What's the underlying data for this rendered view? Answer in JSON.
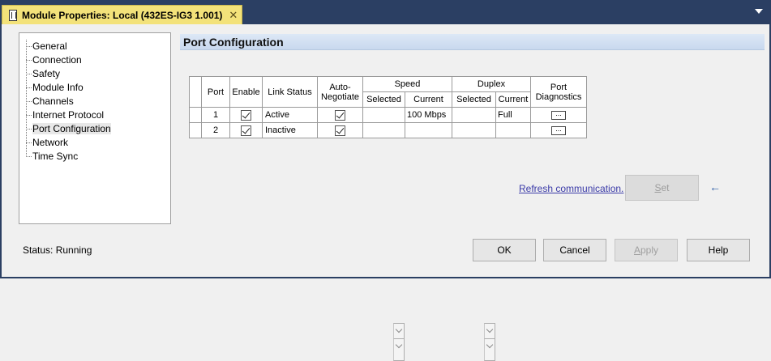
{
  "window": {
    "tab_title": "Module Properties: Local (432ES-IG3 1.001)",
    "close_glyph": "✕"
  },
  "tree": {
    "items": [
      {
        "label": "General",
        "selected": false
      },
      {
        "label": "Connection",
        "selected": false
      },
      {
        "label": "Safety",
        "selected": false
      },
      {
        "label": "Module Info",
        "selected": false
      },
      {
        "label": "Channels",
        "selected": false
      },
      {
        "label": "Internet Protocol",
        "selected": false
      },
      {
        "label": "Port Configuration",
        "selected": true
      },
      {
        "label": "Network",
        "selected": false
      },
      {
        "label": "Time Sync",
        "selected": false
      }
    ]
  },
  "section": {
    "title": "Port Configuration"
  },
  "table": {
    "headers": {
      "port": "Port",
      "enable": "Enable",
      "link_status": "Link Status",
      "auto_negotiate_1": "Auto-",
      "auto_negotiate_2": "Negotiate",
      "speed": "Speed",
      "duplex": "Duplex",
      "port_diag_1": "Port",
      "port_diag_2": "Diagnostics",
      "selected": "Selected",
      "current": "Current"
    },
    "rows": [
      {
        "port": "1",
        "enable": true,
        "link_status": "Active",
        "auto_negotiate": true,
        "speed_selected": "",
        "speed_current": "100 Mbps",
        "duplex_selected": "",
        "duplex_current": "Full",
        "diag_label": "..."
      },
      {
        "port": "2",
        "enable": true,
        "link_status": "Inactive",
        "auto_negotiate": true,
        "speed_selected": "",
        "speed_current": "",
        "duplex_selected": "",
        "duplex_current": "",
        "diag_label": "..."
      }
    ]
  },
  "refresh_link": "Refresh communication.",
  "set_button": {
    "label": "Set",
    "mnemonic": "S",
    "rest": "et",
    "enabled": false
  },
  "arrow_glyph": "←",
  "status": {
    "label": "Status:",
    "value": "Running"
  },
  "buttons": {
    "ok": "OK",
    "cancel": "Cancel",
    "apply": {
      "label": "Apply",
      "mnemonic": "A",
      "rest": "pply",
      "enabled": false
    },
    "help": "Help"
  }
}
